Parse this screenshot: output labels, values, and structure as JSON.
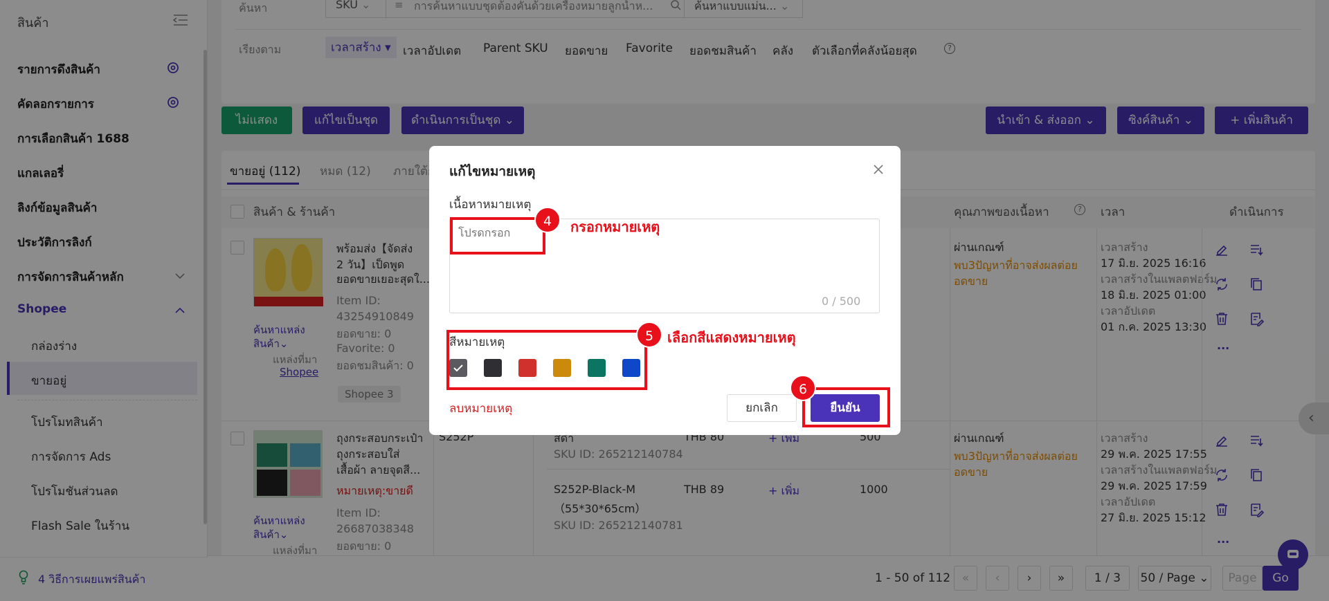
{
  "sidebar": {
    "header": "สินค้า",
    "items": [
      {
        "label": "รายการดึงสินค้า"
      },
      {
        "label": "คัดลอกรายการ"
      },
      {
        "label": "การเลือกสินค้า 1688"
      },
      {
        "label": "แกลเลอรี่"
      },
      {
        "label": "ลิงก์ข้อมูลสินค้า"
      },
      {
        "label": "ประวัติการลิงก์"
      },
      {
        "label": "การจัดการสินค้าหลัก"
      },
      {
        "label": "Shopee"
      }
    ],
    "sub_items": [
      "กล่องร่าง",
      "ขายอยู่",
      "โปรโมทสินค้า",
      "การจัดการ Ads",
      "โปรโมชันส่วนลด",
      "Flash Sale ในร้าน"
    ],
    "footer": "4 วิธีการเผยแพร่สินค้า"
  },
  "filters": {
    "search_label": "ค้นหา",
    "sku_select": "SKU",
    "search_placeholder": "การค้นหาแบบชุดต้องคั่นด้วยเครื่องหมายลูกน้ำห...",
    "mode_select": "ค้นหาแบบแม่น...",
    "sort_label": "เรียงตาม",
    "sort_items": [
      "เวลาสร้าง ▾",
      "เวลาอัปเดต",
      "Parent SKU",
      "ยอดขาย",
      "Favorite",
      "ยอดชมสินค้า",
      "คลัง",
      "ตัวเลือกที่คลังน้อยสุด"
    ]
  },
  "toolbar": {
    "hide": "ไม่แสดง",
    "bulk_edit": "แก้ไขเป็นชุด",
    "bulk_action": "ดำเนินการเป็นชุด ⌄",
    "import_export": "นำเข้า & ส่งออก ⌄",
    "sync": "ซิงค์สินค้า ⌄",
    "add": "+ เพิ่มสินค้า"
  },
  "tabs": [
    "ขายอยู่ (112)",
    "หมด (12)",
    "ภายใต้ก"
  ],
  "table": {
    "headers": {
      "product": "สินค้า & ร้านค้า",
      "quality": "คุณภาพของเนื้อหา",
      "time": "เวลา",
      "actions": "ดำเนินการ"
    },
    "row1": {
      "title": [
        "พร้อมส่ง【จัดส่ง",
        "2 วัน】เป็ดพูด",
        "ยอดขายเยอะสุดใ..."
      ],
      "source_link": [
        "ค้นหาแหล่ง",
        "สินค้า⌄"
      ],
      "source_from": "แหล่งที่มา",
      "source_shop": "Shopee",
      "item_id_label": "Item ID:",
      "item_id": "43254910849",
      "sales": "ยอดขาย: 0",
      "favorite": "Favorite: 0",
      "views": "ยอดชมสินค้า: 0",
      "shop_tag": "Shopee 3",
      "quality": "ผ่านเกณฑ์",
      "quality_warn": [
        "พบ3ปัญหาที่อาจส่งผลต่อย",
        "อดขาย"
      ],
      "times": [
        "เวลาสร้าง",
        "17 มิ.ย. 2025 16:16",
        "เวลาสร้างในแพลตฟอร์ม",
        "18 มิ.ย. 2025 01:00",
        "เวลาอัปเดต",
        "01 ก.ค. 2025 13:30"
      ]
    },
    "row2": {
      "title": [
        "ถุงกระสอบกระเป๋า",
        "ถุงกระสอบใส่",
        "เสื้อผ้า ลายจุดสี..."
      ],
      "note": "หมายเหตุ:ขายดี",
      "source_link": [
        "ค้นหาแหล่ง",
        "สินค้า⌄"
      ],
      "source_from": "แหล่งที่มา",
      "item_id_label": "Item ID:",
      "item_id": "26687038348",
      "sales": "ยอดขาย: 0",
      "parent_sku": "S252P",
      "v1_name": "สีดำ",
      "v1_sku": "SKU ID: 265212140784",
      "v1_price": "THB 80",
      "v1_add": "+ เพิ่ม",
      "v1_stock": "500",
      "v2_name": [
        "S252P-Black-M",
        "（55*30*65cm）"
      ],
      "v2_sku": "SKU ID: 265212140781",
      "v2_price": "THB 89",
      "v2_add": "+ เพิ่ม",
      "v2_stock": "1000",
      "quality": "ผ่านเกณฑ์",
      "quality_warn": [
        "พบ3ปัญหาที่อาจส่งผลต่อย",
        "อดขาย"
      ],
      "times": [
        "เวลาสร้าง",
        "29 พ.ค. 2025 17:55",
        "เวลาสร้างในแพลตฟอร์ม",
        "29 พ.ค. 2025 17:59",
        "เวลาอัปเดต",
        "27 มิ.ย. 2025 15:12"
      ]
    },
    "more": "..."
  },
  "pagination": {
    "summary": "1 - 50 of 112",
    "current": "1 / 3",
    "page_size": "50 / Page",
    "page_placeholder": "Page",
    "go": "Go"
  },
  "modal": {
    "title": "แก้ไขหมายเหตุ",
    "content_label": "เนื้อหาหมายเหตุ",
    "placeholder": "โปรดกรอก",
    "counter": "0 / 500",
    "color_label": "สีหมายเหตุ",
    "colors": [
      "#5a5a60",
      "#2f2f33",
      "#d0312d",
      "#cc8a0c",
      "#0a7560",
      "#0f47c9"
    ],
    "delete": "ลบหมายเหตุ",
    "cancel": "ยกเลิก",
    "confirm": "ยืนยัน"
  },
  "annotations": {
    "step4": "4",
    "step4_text": "กรอกหมายเหตุ",
    "step5": "5",
    "step5_text": "เลือกสีแสดงหมายเหตุ",
    "step6": "6"
  }
}
